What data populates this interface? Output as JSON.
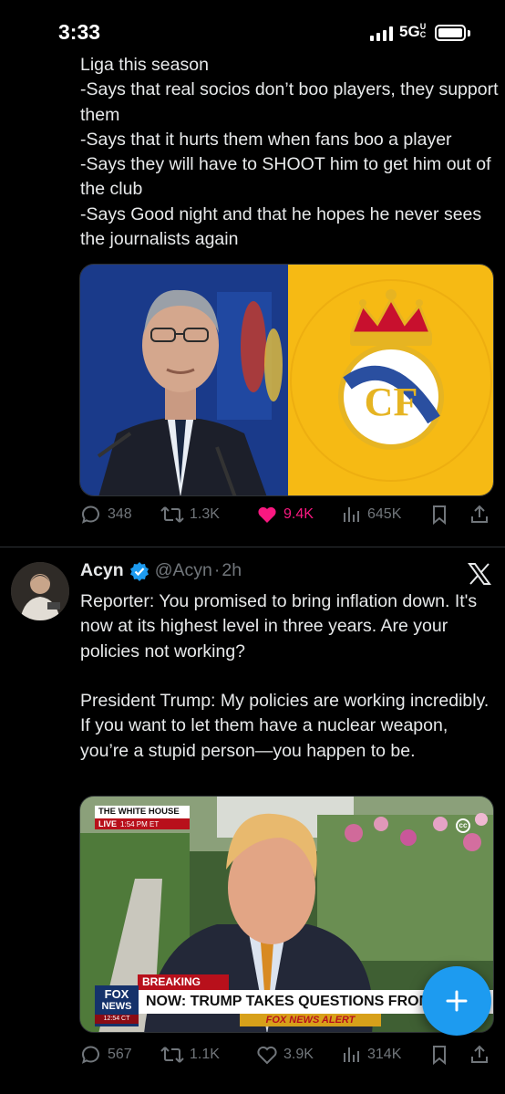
{
  "status_bar": {
    "time": "3:33",
    "network": "5G",
    "network_suffix": "UC"
  },
  "tweet1": {
    "text": "Liga this season\n-Says that real socios don’t boo players, they support them\n-Says that it hurts them when fans boo a player\n-Says they will have to SHOOT him to get him out of the club\n-Says Good night and that he hopes he never sees the journalists again",
    "replies": "348",
    "reposts": "1.3K",
    "likes": "9.4K",
    "views": "645K",
    "liked": true
  },
  "tweet2": {
    "author_name": "Acyn",
    "author_handle": "@Acyn",
    "separator": "·",
    "time": "2h",
    "text": "Reporter: You promised to bring inflation down. It's now at its highest level in three years. Are your policies not working?\n\nPresident Trump: My policies are working incredibly. If you want to let them have a nuclear weapon, you’re a stupid person—you happen to be.",
    "media": {
      "tag_top": "THE WHITE HOUSE",
      "tag_live": "LIVE",
      "tag_time": "1:54 PM ET",
      "breaking": "BREAKING NEWS",
      "headline": "NOW: TRUMP TAKES QUESTIONS FROM REP",
      "logo_top": "FOX",
      "logo_bottom": "NEWS",
      "logo_time": "12:54 CT",
      "alert": "FOX NEWS ALERT",
      "cc": "cc"
    },
    "replies": "567",
    "reposts": "1.1K",
    "likes": "3.9K",
    "views": "314K"
  },
  "colors": {
    "background": "#000000",
    "text": "#e7e9ea",
    "muted": "#71767b",
    "like": "#f91880",
    "accent": "#1d9bf0",
    "divider": "#2f3336"
  },
  "icons": {
    "reply": "speech-bubble-icon",
    "repost": "repost-arrows-icon",
    "like": "heart-icon",
    "views": "bar-chart-icon",
    "bookmark": "bookmark-icon",
    "share": "share-icon",
    "verified": "verified-badge-icon",
    "platform": "x-logo-icon",
    "compose": "plus-icon"
  }
}
